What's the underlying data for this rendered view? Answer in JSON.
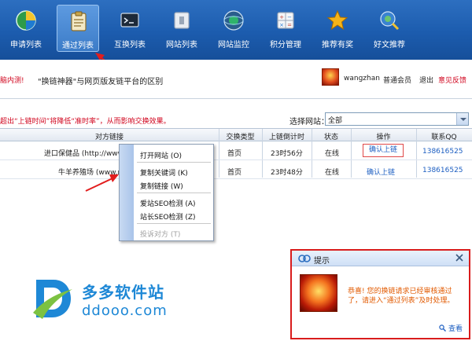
{
  "toolbar": {
    "items": [
      {
        "label": "申请列表",
        "icon": "pie-chart-icon"
      },
      {
        "label": "通过列表",
        "icon": "clipboard-icon",
        "active": true
      },
      {
        "label": "互换列表",
        "icon": "terminal-icon"
      },
      {
        "label": "网站列表",
        "icon": "window-icon"
      },
      {
        "label": "网站监控",
        "icon": "globe-icon"
      },
      {
        "label": "积分管理",
        "icon": "calculator-icon"
      },
      {
        "label": "推荐有奖",
        "icon": "star-icon"
      },
      {
        "label": "好文推荐",
        "icon": "globe-search-icon"
      }
    ]
  },
  "notice": {
    "left_fragment": "脑内测!",
    "middle_text": "\"换链神器\"与网页版友链平台的区别"
  },
  "user": {
    "name": "wangzhan",
    "level": "普通会员",
    "logout": "退出",
    "feedback": "意见反馈"
  },
  "warning": {
    "text": "超出“上链时间”将降低“准时率”，从而影响交换效果。"
  },
  "site_filter": {
    "label": "选择网站：",
    "value": "全部"
  },
  "table": {
    "headers": [
      "对方链接",
      "交换类型",
      "上链倒计时",
      "状态",
      "操作",
      "联系QQ"
    ],
    "rows": [
      {
        "link": "进口保健品 (http://www",
        "type": "首页",
        "countdown": "23时56分",
        "status": "在线",
        "action": "确认上链",
        "qq": "138616525"
      },
      {
        "link": "牛羊养殖场 (www.n",
        "type": "首页",
        "countdown": "23时48分",
        "status": "在线",
        "action": "确认上链",
        "qq": "138616525"
      }
    ]
  },
  "context_menu": {
    "items": [
      {
        "label": "打开网站 (O)",
        "disabled": false
      },
      {
        "label": "复制关键词 (K)",
        "disabled": false
      },
      {
        "label": "复制链接 (W)",
        "disabled": false
      },
      {
        "label": "爱站SEO检测 (A)",
        "disabled": false
      },
      {
        "label": "站长SEO检测 (Z)",
        "disabled": false
      },
      {
        "label": "投诉对方 (T)",
        "disabled": true
      }
    ]
  },
  "watermark": {
    "title": "多多软件站",
    "url": "ddooo.com"
  },
  "popup": {
    "title": "提示",
    "message_line1": "恭喜! 您的换链请求已经审核通过",
    "message_line2": "了，请进入“通过列表”及时处理。",
    "view_label": "查看"
  },
  "colors": {
    "toolbar_blue": "#1c5cae",
    "alert_red": "#d0021b",
    "link_blue": "#1d5fc2",
    "popup_text": "#e25a00"
  }
}
